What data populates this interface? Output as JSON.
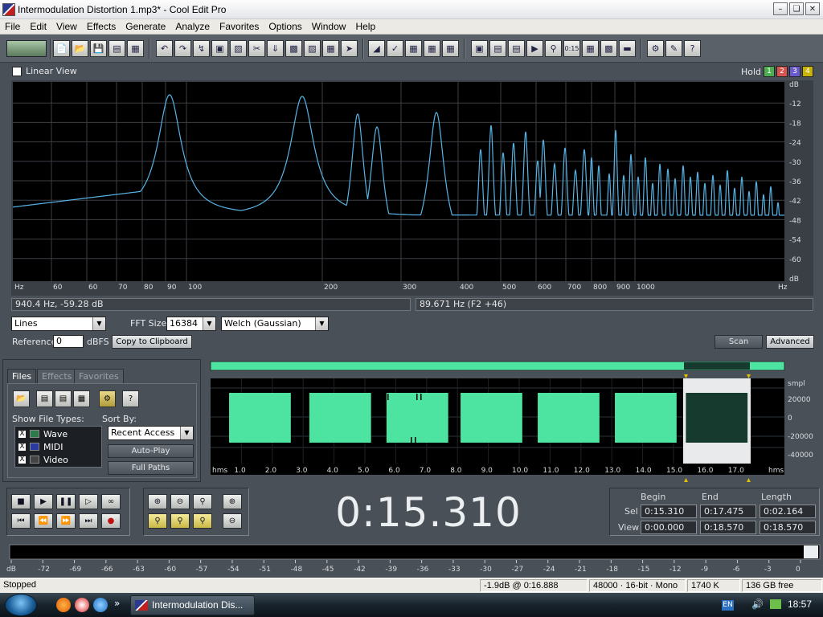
{
  "window": {
    "title": "Intermodulation Distortion 1.mp3* - Cool Edit Pro"
  },
  "menu": [
    "File",
    "Edit",
    "View",
    "Effects",
    "Generate",
    "Analyze",
    "Favorites",
    "Options",
    "Window",
    "Help"
  ],
  "spectrum": {
    "linear_view_label": "Linear View",
    "hold_label": "Hold",
    "hold_buttons": [
      "1",
      "2",
      "3",
      "4"
    ],
    "hold_colors": [
      "#4caf50",
      "#d9534f",
      "#6a5acd",
      "#c8b400"
    ],
    "db_labels": [
      "dB",
      "-12",
      "-18",
      "-24",
      "-30",
      "-36",
      "-42",
      "-48",
      "-54",
      "-60",
      "dB"
    ],
    "hz_labels": [
      "Hz",
      "60",
      "60",
      "70",
      "80",
      "90",
      "100",
      "200",
      "300",
      "400",
      "500",
      "600",
      "700",
      "800",
      "900",
      "1000",
      "Hz"
    ],
    "cursor_readout": "940.4 Hz, -59.28 dB",
    "peak_readout": "89.671 Hz (F2 +46)",
    "plot_style": "Lines",
    "fft_size_label": "FFT Size",
    "fft_size": "16384",
    "window_fn": "Welch (Gaussian)",
    "reference_label": "Reference",
    "reference_value": "0",
    "reference_unit": "dBFS",
    "copy_button": "Copy to Clipboard",
    "scan_button": "Scan",
    "advanced_button": "Advanced",
    "line_color": "#58b4e6"
  },
  "organizer": {
    "tabs": [
      "Files",
      "Effects",
      "Favorites"
    ],
    "show_file_types_label": "Show File Types:",
    "sort_by_label": "Sort By:",
    "file_types": [
      {
        "label": "Wave",
        "checked": "X"
      },
      {
        "label": "MIDI",
        "checked": "X"
      },
      {
        "label": "Video",
        "checked": "X"
      }
    ],
    "sort_value": "Recent Access",
    "auto_play_button": "Auto-Play",
    "full_paths_button": "Full Paths"
  },
  "waveform": {
    "amp_labels": [
      "smpl",
      "20000",
      "0",
      "-20000",
      "-40000"
    ],
    "time_labels": [
      "hms",
      "1.0",
      "2.0",
      "3.0",
      "4.0",
      "5.0",
      "6.0",
      "7.0",
      "8.0",
      "9.0",
      "10.0",
      "11.0",
      "12.0",
      "13.0",
      "14.0",
      "15.0",
      "16.0",
      "17.0",
      "hms"
    ],
    "wave_color": "#4de3a0",
    "selection_color": "#173a2e"
  },
  "transport": {
    "time": "0:15.310",
    "begin_header": "Begin",
    "end_header": "End",
    "length_header": "Length",
    "sel_label": "Sel",
    "view_label": "View",
    "sel_begin": "0:15.310",
    "sel_end": "0:17.475",
    "sel_length": "0:02.164",
    "view_begin": "0:00.000",
    "view_end": "0:18.570",
    "view_length": "0:18.570"
  },
  "meter": {
    "labels": [
      "dB",
      "-72",
      "-69",
      "-66",
      "-63",
      "-60",
      "-57",
      "-54",
      "-51",
      "-48",
      "-45",
      "-42",
      "-39",
      "-36",
      "-33",
      "-30",
      "-27",
      "-24",
      "-21",
      "-18",
      "-15",
      "-12",
      "-9",
      "-6",
      "-3",
      "0"
    ]
  },
  "statusbar": {
    "state": "Stopped",
    "level": "-1.9dB @  0:16.888",
    "format": "48000 · 16-bit · Mono",
    "size": "1740 K",
    "free": "136 GB free"
  },
  "taskbar": {
    "task_label": "Intermodulation Dis...",
    "lang": "EN",
    "clock": "18:57"
  }
}
